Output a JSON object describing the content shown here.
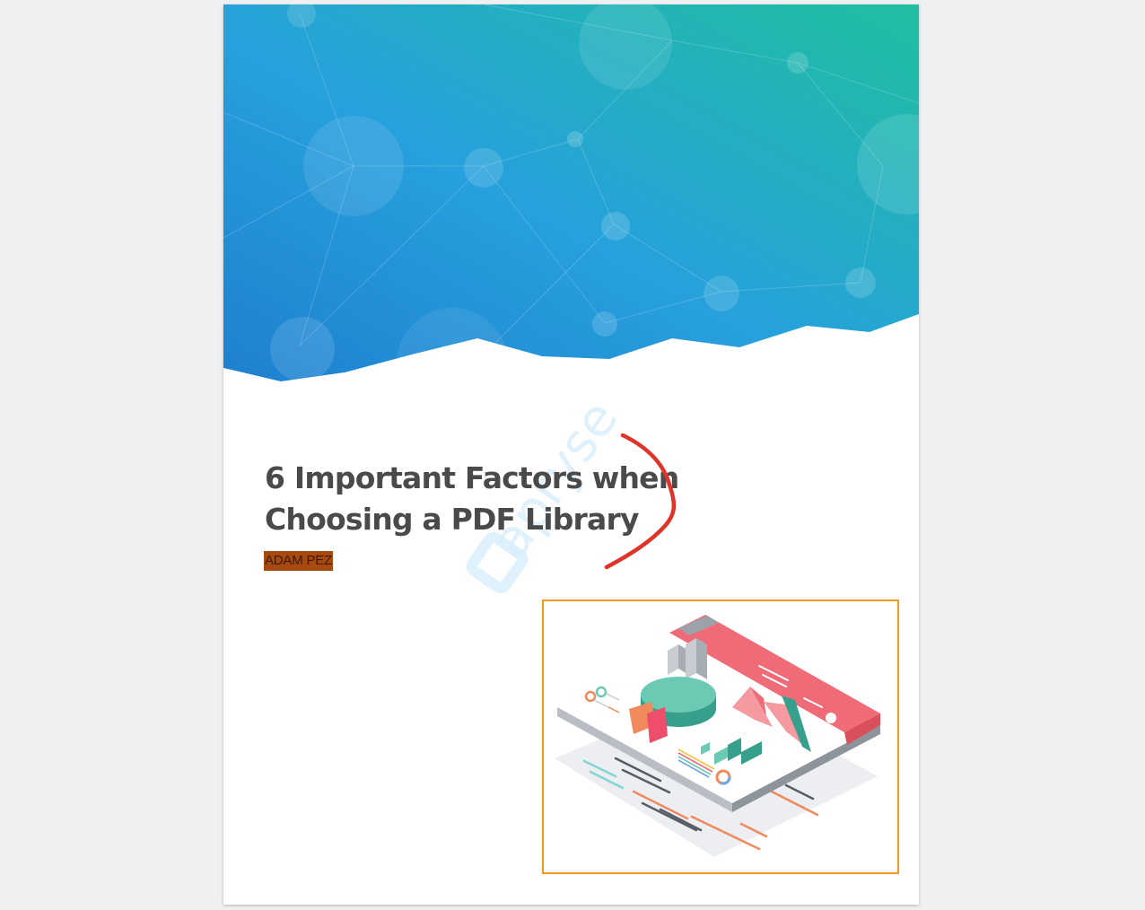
{
  "document": {
    "title_lines": [
      "6 Important Factors when",
      "Choosing a PDF Library"
    ],
    "author": "ADAM PEZ",
    "watermark": "apryse"
  },
  "colors": {
    "viewer_background": "#eef0f2",
    "header_gradient_start": "#1e7fcf",
    "header_gradient_end": "#1fbfa0",
    "title_text": "#4a4a4a",
    "author_highlight": "#a84a10",
    "ink_annotation": "#e0342a",
    "selection_outline": "#f39a1d",
    "watermark": "#d8eefc"
  },
  "annotations": {
    "ink_stroke": "red-freehand-bracket",
    "rectangle": "orange-selection-box"
  },
  "illustration": {
    "subject": "isometric-dashboard-icon"
  }
}
